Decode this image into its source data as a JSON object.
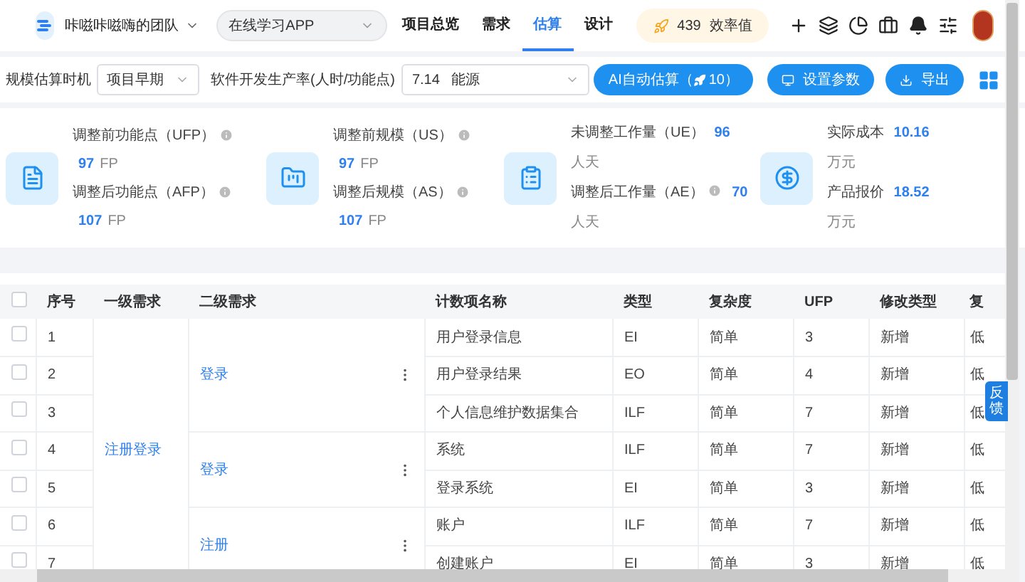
{
  "header": {
    "team": "咔嗞咔嗞嗨的团队",
    "project": "在线学习APP",
    "nav": [
      {
        "label": "项目总览",
        "selected": false
      },
      {
        "label": "需求",
        "selected": false
      },
      {
        "label": "估算",
        "selected": true
      },
      {
        "label": "设计",
        "selected": false
      }
    ],
    "efficiency": {
      "value": "439",
      "label": "效率值"
    }
  },
  "toolbar": {
    "timing_label": "规模估算时机",
    "timing_value": "项目早期",
    "rate_label": "软件开发生产率(人时/功能点)",
    "rate_value": "7.14",
    "rate_domain": "能源",
    "ai_button": {
      "label": "AI自动估算（",
      "count": "10",
      "close": "）"
    },
    "settings_button": "设置参数",
    "export_button": "导出"
  },
  "stats": [
    {
      "kind": "stacked",
      "lines": [
        {
          "label": "调整前功能点（UFP）",
          "info": true,
          "value": "97",
          "unit": "FP"
        },
        {
          "label": "调整后功能点（AFP）",
          "info": true,
          "value": "107",
          "unit": "FP"
        }
      ]
    },
    {
      "kind": "stacked",
      "lines": [
        {
          "label": "调整前规模（US）",
          "info": true,
          "value": "97",
          "unit": "FP"
        },
        {
          "label": "调整后规模（AS）",
          "info": true,
          "value": "107",
          "unit": "FP"
        }
      ]
    },
    {
      "kind": "inline",
      "lines": [
        {
          "label": "未调整工作量（UE）",
          "info": false,
          "value": "96",
          "unit": "人天"
        },
        {
          "label": "调整后工作量（AE）",
          "info": true,
          "value": "70",
          "unit": "人天"
        }
      ]
    },
    {
      "kind": "inline",
      "lines": [
        {
          "label": "实际成本",
          "info": false,
          "value": "10.16",
          "unit": "万元"
        },
        {
          "label": "产品报价",
          "info": false,
          "value": "18.52",
          "unit": "万元"
        }
      ]
    }
  ],
  "table": {
    "select_all_checked": false,
    "columns": [
      "序号",
      "一级需求",
      "二级需求",
      "计数项名称",
      "类型",
      "复杂度",
      "UFP",
      "修改类型",
      "复"
    ],
    "groups": [
      {
        "level1": "注册登录",
        "children": [
          {
            "level2": "登录",
            "rows": [
              {
                "checked": false,
                "no": "1",
                "name": "用户登录信息",
                "type": "EI",
                "complexity": "简单",
                "ufp": "3",
                "change": "新增",
                "reuse": "低"
              },
              {
                "checked": false,
                "no": "2",
                "name": "用户登录结果",
                "type": "EO",
                "complexity": "简单",
                "ufp": "4",
                "change": "新增",
                "reuse": "低"
              },
              {
                "checked": false,
                "no": "3",
                "name": "个人信息维护数据集合",
                "type": "ILF",
                "complexity": "简单",
                "ufp": "7",
                "change": "新增",
                "reuse": "低"
              }
            ]
          },
          {
            "level2": "登录",
            "rows": [
              {
                "checked": false,
                "no": "4",
                "name": "系统",
                "type": "ILF",
                "complexity": "简单",
                "ufp": "7",
                "change": "新增",
                "reuse": "低"
              },
              {
                "checked": false,
                "no": "5",
                "name": "登录系统",
                "type": "EI",
                "complexity": "简单",
                "ufp": "3",
                "change": "新增",
                "reuse": "低"
              }
            ]
          },
          {
            "level2": "注册",
            "rows": [
              {
                "checked": false,
                "no": "6",
                "name": "账户",
                "type": "ILF",
                "complexity": "简单",
                "ufp": "7",
                "change": "新增",
                "reuse": "低"
              },
              {
                "checked": false,
                "no": "7",
                "name": "创建账户",
                "type": "EI",
                "complexity": "简单",
                "ufp": "3",
                "change": "新增",
                "reuse": "低"
              }
            ]
          }
        ]
      }
    ]
  },
  "feedback": "反馈"
}
